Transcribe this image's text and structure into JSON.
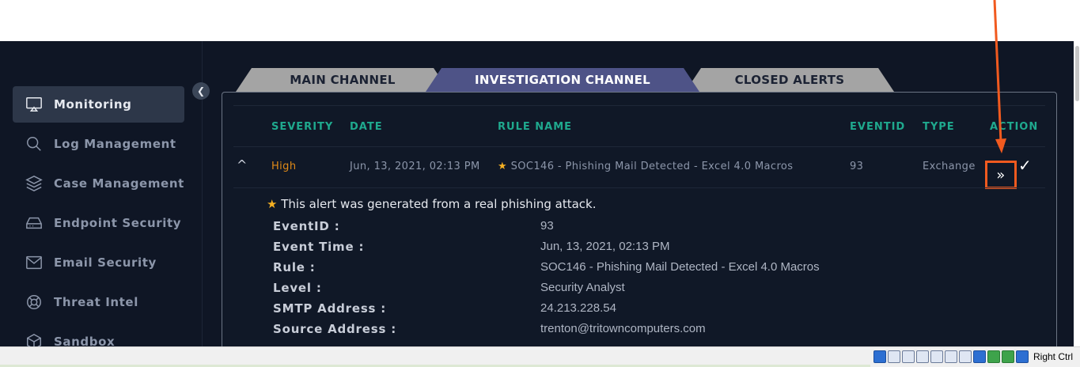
{
  "sidebar": {
    "items": [
      {
        "label": "Monitoring",
        "icon": "monitor-icon",
        "active": true
      },
      {
        "label": "Log Management",
        "icon": "search-icon"
      },
      {
        "label": "Case Management",
        "icon": "layers-icon"
      },
      {
        "label": "Endpoint Security",
        "icon": "hard-drive-icon"
      },
      {
        "label": "Email Security",
        "icon": "mail-icon"
      },
      {
        "label": "Threat Intel",
        "icon": "lifebuoy-icon"
      },
      {
        "label": "Sandbox",
        "icon": "cube-icon"
      }
    ],
    "collapse_glyph": "❮"
  },
  "tabs": {
    "main": "MAIN CHANNEL",
    "investigation": "INVESTIGATION CHANNEL",
    "closed": "CLOSED ALERTS"
  },
  "table": {
    "headers": {
      "severity": "SEVERITY",
      "date": "DATE",
      "rule": "RULE NAME",
      "eventid": "EVENTID",
      "type": "TYPE",
      "action": "ACTION"
    },
    "row": {
      "severity": "High",
      "date": "Jun, 13, 2021, 02:13 PM",
      "star": "★",
      "rule": "SOC146 - Phishing Mail Detected - Excel 4.0 Macros",
      "eventid": "93",
      "type": "Exchange",
      "expand_glyph": "^",
      "action_take_glyph": "»",
      "action_close_glyph": "✓"
    }
  },
  "detail": {
    "note_star": "★",
    "note": "This alert was generated from a real phishing attack.",
    "fields": [
      {
        "key": "EventID :",
        "value": "93"
      },
      {
        "key": "Event Time :",
        "value": "Jun, 13, 2021, 02:13 PM"
      },
      {
        "key": "Rule :",
        "value": "SOC146 - Phishing Mail Detected - Excel 4.0 Macros"
      },
      {
        "key": "Level :",
        "value": "Security Analyst"
      },
      {
        "key": "SMTP Address :",
        "value": "24.213.228.54"
      },
      {
        "key": "Source Address :",
        "value": "trenton@tritowncomputers.com"
      }
    ]
  },
  "taskbar": {
    "host_key": "Right Ctrl"
  },
  "colors": {
    "accent_teal": "#1fa98e",
    "severity_high": "#e08a17",
    "annotation": "#f15a1f",
    "active_tab": "#4e5387"
  }
}
